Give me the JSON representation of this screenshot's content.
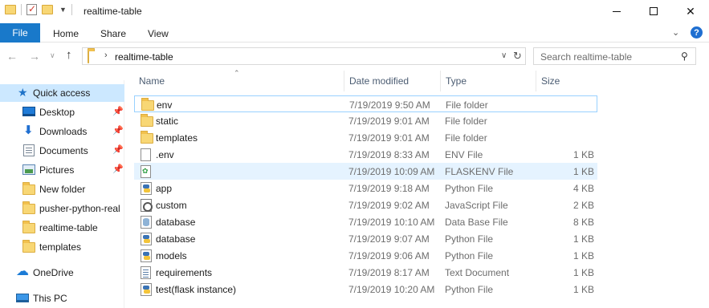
{
  "window": {
    "title": "realtime-table"
  },
  "ribbon": {
    "file_label": "File",
    "tabs": [
      "Home",
      "Share",
      "View"
    ],
    "help": "?"
  },
  "address": {
    "path": "realtime-table",
    "search_placeholder": "Search realtime-table"
  },
  "sidebar": {
    "items": [
      {
        "label": "Quick access",
        "icon": "star-icon"
      },
      {
        "label": "Desktop",
        "icon": "desktop-icon"
      },
      {
        "label": "Downloads",
        "icon": "downloads-icon"
      },
      {
        "label": "Documents",
        "icon": "documents-icon"
      },
      {
        "label": "Pictures",
        "icon": "pictures-icon"
      },
      {
        "label": "New folder",
        "icon": "folder-icon"
      },
      {
        "label": "pusher-python-real",
        "icon": "folder-icon"
      },
      {
        "label": "realtime-table",
        "icon": "folder-icon"
      },
      {
        "label": "templates",
        "icon": "folder-icon"
      },
      {
        "label": "OneDrive",
        "icon": "onedrive-icon"
      },
      {
        "label": "This PC",
        "icon": "this-pc-icon"
      }
    ]
  },
  "columns": {
    "name": "Name",
    "date": "Date modified",
    "type": "Type",
    "size": "Size"
  },
  "files": [
    {
      "name": "env",
      "date": "7/19/2019 9:50 AM",
      "type": "File folder",
      "size": "",
      "icon": "folder-icon"
    },
    {
      "name": "static",
      "date": "7/19/2019 9:01 AM",
      "type": "File folder",
      "size": "",
      "icon": "folder-icon"
    },
    {
      "name": "templates",
      "date": "7/19/2019 9:01 AM",
      "type": "File folder",
      "size": "",
      "icon": "folder-icon"
    },
    {
      "name": ".env",
      "date": "7/19/2019 8:33 AM",
      "type": "ENV File",
      "size": "1 KB",
      "icon": "file-icon"
    },
    {
      "name": "",
      "date": "7/19/2019 10:09 AM",
      "type": "FLASKENV File",
      "size": "1 KB",
      "icon": "flaskenv-file-icon"
    },
    {
      "name": "app",
      "date": "7/19/2019 9:18 AM",
      "type": "Python File",
      "size": "4 KB",
      "icon": "python-file-icon"
    },
    {
      "name": "custom",
      "date": "7/19/2019 9:02 AM",
      "type": "JavaScript File",
      "size": "2 KB",
      "icon": "javascript-file-icon"
    },
    {
      "name": "database",
      "date": "7/19/2019 10:10 AM",
      "type": "Data Base File",
      "size": "8 KB",
      "icon": "database-file-icon"
    },
    {
      "name": "database",
      "date": "7/19/2019 9:07 AM",
      "type": "Python File",
      "size": "1 KB",
      "icon": "python-file-icon"
    },
    {
      "name": "models",
      "date": "7/19/2019 9:06 AM",
      "type": "Python File",
      "size": "1 KB",
      "icon": "python-file-icon"
    },
    {
      "name": "requirements",
      "date": "7/19/2019 8:17 AM",
      "type": "Text Document",
      "size": "1 KB",
      "icon": "text-file-icon"
    },
    {
      "name": "test(flask instance)",
      "date": "7/19/2019 10:20 AM",
      "type": "Python File",
      "size": "1 KB",
      "icon": "python-file-icon"
    }
  ],
  "colors": {
    "accent": "#1979ca",
    "selection": "#cce8ff",
    "hover": "#e5f3ff"
  }
}
